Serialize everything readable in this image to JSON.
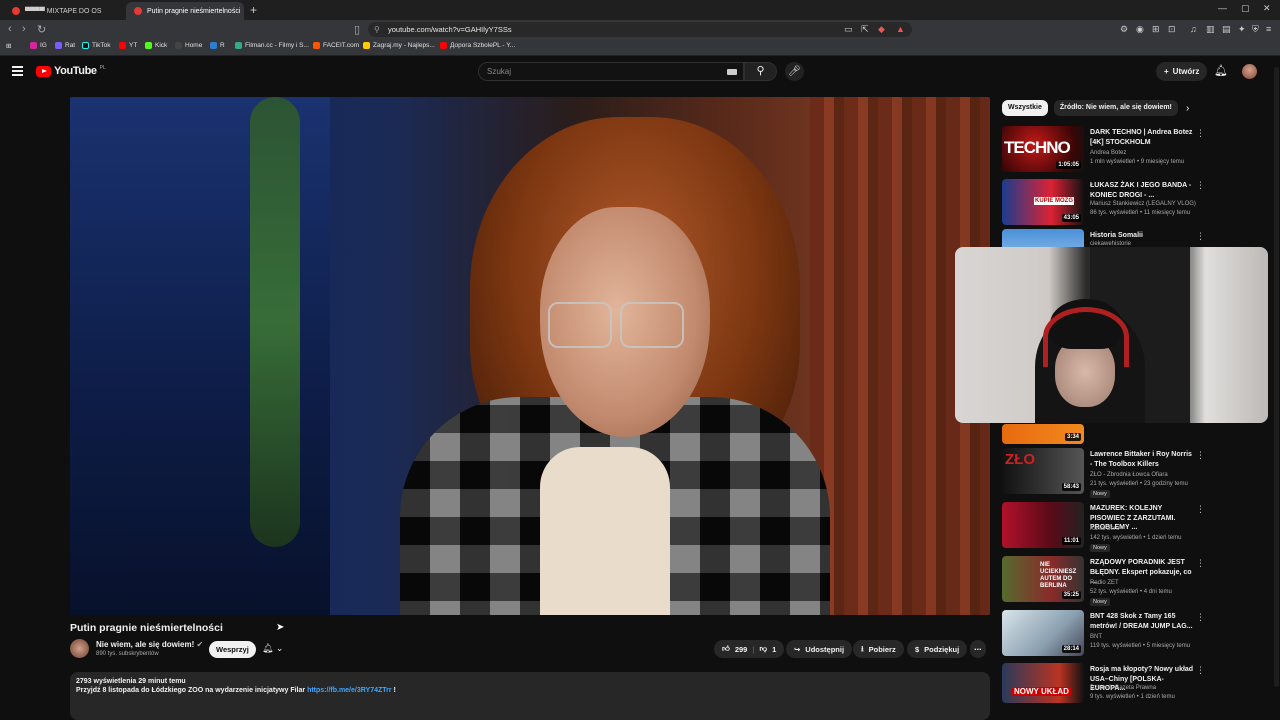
{
  "browser": {
    "tabs": [
      {
        "label": "▀▀▀▀ MIXTAPE DO OS"
      },
      {
        "label": "Putin pragnie nieśmiertelności"
      }
    ],
    "url": "youtube.com/watch?v=GAHIlyY7SSs",
    "bookmarks": [
      "IG",
      "Rat",
      "TikTok",
      "YT",
      "Kick",
      "Home",
      "R",
      "Filman.cc - Filmy i S...",
      "FACEIT.com",
      "Zagraj.my - Najleps...",
      "Дорога SzbolePL - Y..."
    ]
  },
  "header": {
    "logo": "YouTube",
    "country": "PL",
    "search_placeholder": "Szukaj",
    "create_label": "Utwórz"
  },
  "video": {
    "title": "Putin pragnie nieśmiertelności",
    "channel": "Nie wiem, ale się dowiem!",
    "subscribers": "890 tys. subskrybentów",
    "support_label": "Wesprzyj",
    "likes": "299",
    "dislikes": "1",
    "share_label": "Udostępnij",
    "download_label": "Pobierz",
    "thanks_label": "Podziękuj",
    "description_meta": "2793 wyświetlenia  29 minut temu",
    "description_text": "Przyjdź 8 listopada do Łódzkiego ZOO na wydarzenie inicjatywy Filar ",
    "description_link": "https://fb.me/e/3RY74ZTrr",
    "description_tail": " !"
  },
  "sidebar": {
    "chips": [
      "Wszystkie",
      "Źródło: Nie wiem, ale się dowiem!"
    ],
    "items": [
      {
        "title": "DARK TECHNO | Andrea Botez [4K] STOCKHOLM",
        "channel": "Andrea Botez",
        "views": "1 mln wyświetleń • 9 miesięcy temu",
        "duration": "1:05:05",
        "badge": ""
      },
      {
        "title": "ŁUKASZ ŻAK I JEGO BANDA - KONIEC DROGI - ...",
        "channel": "Mariusz Stankiewicz (LEGALNY VLOG)",
        "views": "86 tys. wyświetleń • 11 miesięcy temu",
        "duration": "43:05",
        "badge": ""
      },
      {
        "title": "Historia Somalii",
        "channel": "ciekawehistorie",
        "views": "",
        "duration": "",
        "badge": ""
      },
      {
        "title": "",
        "channel": "",
        "views": "",
        "duration": "3:34",
        "badge": ""
      },
      {
        "title": "Lawrence Bittaker i Roy Norris - The Toolbox Killers",
        "channel": "ZŁO - Zbrodnia Łowca Ofiara",
        "views": "21 tys. wyświetleń • 23 godziny temu",
        "duration": "58:43",
        "badge": "Nowy"
      },
      {
        "title": "MAZUREK: KOLEJNY PISOWIEC Z ZARZUTAMI. PROBLEMY ...",
        "channel": "Kanał Zero",
        "views": "142 tys. wyświetleń • 1 dzień temu",
        "duration": "11:01",
        "badge": "Nowy"
      },
      {
        "title": "RZĄDOWY PORADNIK JEST BŁĘDNY. Ekspert pokazuje, co ...",
        "channel": "Radio ZET",
        "views": "52 tys. wyświetleń • 4 dni temu",
        "duration": "35:25",
        "badge": "Nowy"
      },
      {
        "title": "BNT 428 Skok z Tamy 165 metrów! / DREAM JUMP LAG...",
        "channel": "BNT",
        "views": "119 tys. wyświetleń • 5 miesięcy temu",
        "duration": "28:14",
        "badge": ""
      },
      {
        "title": "Rosja ma kłopoty? Nowy układ USA–Chiny [POLSKA- EUROPA...",
        "channel": "Dziennik Gazeta Prawna",
        "views": "9 tys. wyświetleń • 1 dzień temu",
        "duration": "",
        "badge": ""
      }
    ]
  },
  "colors": {
    "accent": "#ff0000",
    "link": "#3ea6ff",
    "bg": "#0f0f0f"
  }
}
